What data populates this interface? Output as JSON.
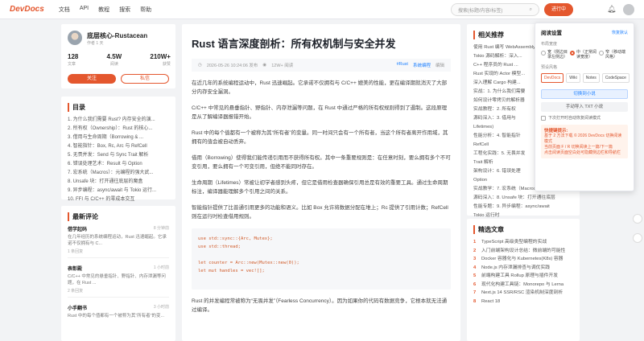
{
  "header": {
    "logo": "DevDocs",
    "nav": [
      "文档",
      "API",
      "教程",
      "搜索",
      "帮助"
    ],
    "search_placeholder": "搜索(标题/内容/标签)",
    "write_label": "进行中"
  },
  "profile": {
    "name": "底层核心-Rustacean",
    "subtitle": "作者 1 天",
    "stats": [
      {
        "value": "128",
        "label": "文章"
      },
      {
        "value": "4.5W",
        "label": "阅读"
      },
      {
        "value": "210W+",
        "label": "获赞"
      }
    ],
    "follow": "关注",
    "message": "私信"
  },
  "toc": {
    "title": "目录",
    "items": [
      "1. 为什么我们需要 Rust? 内存安全的演...",
      "2. 所有权（Ownership）：Rust 的核心...",
      "3. 借用与生命周期（Borrowing & ...",
      "4. 智能指针：Box, Rc, Arc 与 RefCell",
      "5. 无畏并发：Send 与 Sync Trait 解析",
      "6. 错误处理艺术：Result 与 Option",
      "7. 宏系统（Macros）：元编程的强大武...",
      "8. Unsafe 块：打开通往底层的魔盒",
      "9. 异步编程：async/await 与 Tokio 运行...",
      "10. FFI 与 C/C++ 的零成本交互"
    ]
  },
  "comments": {
    "title": "最新评论",
    "items": [
      {
        "user": "借学起码",
        "time": "8 分钟前",
        "text": "在几年经历的系统编程运动，Rust 迅速崛起。它承诺不仅拥有与 C...",
        "meta": "1 条回复"
      },
      {
        "user": "表彰殿",
        "time": "1 小时前",
        "text": "C/C++ 中常见的悬垂指针、野指针、内存泄漏等问题，在 Rust ...",
        "meta": "2 条回复"
      },
      {
        "user": "小手翻书",
        "time": "3 小时前",
        "text": "Rust 中的每个值都有一个被称为其“所有者”的变...",
        "meta": ""
      }
    ]
  },
  "article": {
    "title": "Rust 语言深度剖析：所有权机制与安全并发",
    "meta_date": "2026-05-26 10:24:06 发布",
    "meta_views": "12W+ 阅读",
    "meta_tag": "#Rust",
    "meta_tag2": "系统编程",
    "meta_edit": "编辑",
    "paragraphs": [
      "在近几年的系统编程运动中，Rust 迅速崛起。它承诺不仅拥有与 C/C++ 媲美的性能，更在编译期就消灭了大部分内存安全漏洞。",
      "C/C++ 中常见的悬垂指针、野指针、内存泄漏等问题，在 Rust 中通过严格的所有权规则得到了遏制。这段原理是从了解编译器报错开始。",
      "Rust 中的每个值都有一个被称为其“所有者”的变量。同一时间只会有一个所有者，当这个所有者离开作用域，其拥有的值会被自动丢弃。",
      "借用（Borrowing）使得我们能传递引用而不获得所有权。其中一条重要规则是：在任意时刻，要么拥有多个不可变引用，要么拥有一个可变引用，但绝不能同时存在。",
      "生命周期（Lifetimes）常被让初学者感到头疼，但它是借用检查器确保引用总是有效的重要工具。通过生命周期标注，编译器能理解多个引用之间的关系。",
      "智能指针提供了比普通引用更多的功能和语义。比如 Box 允许将数据分配在堆上；Rc 提供了引用计数；RefCell 则在运行时检查借用规则。"
    ],
    "code": [
      "use std::sync::{Arc, Mutex};",
      "use std::thread;",
      "",
      "let counter = Arc::new(Mutex::new(0));",
      "let mut handles = vec![];"
    ],
    "after_code": "Rust 的并发编程常被称为“无畏并发”（Fearless Concurrency）。因为如果你的代码有数据竞争，它根本就无法通过编译。"
  },
  "related": {
    "title": "相关推荐",
    "items": [
      "使用 Rust 编写 WebAssembly...",
      "Tokio 源码解析：深入...",
      "C++ 程序员的 Rust ...",
      "Rust 实现的 Actor 模型...",
      "深入理解 Cargo 构建...",
      "实战：1. 为什么我们需要",
      "如何设计零拷贝的解析器",
      "实战教程：2. 所有权",
      "源码深入：3. 借用与",
      "Lifetimes)",
      "性能分析：4. 智能指针",
      "RefCell",
      "工程化实践：5. 无畏并发",
      "Trait 解析",
      "架构设计：6. 错误处理",
      "Option",
      "实战教学：7. 宏系统（Macros）：元编程",
      "源码深入：8. Unsafe 块：打开通往底层",
      "性能专题：9. 异步编程：async/await",
      "Tokio 运行时"
    ]
  },
  "picks": {
    "title": "精选文章",
    "items": [
      "TypeScript 高级类型编程的实战",
      "入门前端架构设计总结：微前端的可能性",
      "Docker 容器化与 Kubernetes(K8s) 容器",
      "Node.js 内存泄漏排查与调优实践",
      "前端构建工具 Rollup 原理与插件开发",
      "现代化构建工具链：Monorepo 与 Lerna",
      "Next.js 14 SSR/RSC 渲染机制深度剖析",
      "React 18"
    ]
  },
  "settings_panel": {
    "title": "阅读设置",
    "reset": "恢复默认",
    "width_label": "布局宽度",
    "width_options": [
      {
        "label": "宽（侧边目录左侧边）",
        "selected": false
      },
      {
        "label": "中（正常阅读宽度）",
        "selected": true
      },
      {
        "label": "窄（移动端风格）",
        "selected": false
      }
    ],
    "preset_label": "预设风格",
    "presets": [
      {
        "label": "DevDocs",
        "selected": true
      },
      {
        "label": "Wiki",
        "selected": false
      },
      {
        "label": "Notes",
        "selected": false
      },
      {
        "label": "CodeSpace",
        "selected": false
      }
    ],
    "btn_primary": "切换到小说",
    "btn_secondary": "手动导入 TXT 小说",
    "check_label": "下次打开时自动恢复阅读模式",
    "tips_title": "快捷键提示:",
    "tips": [
      "基于 2 方法下载 © 2026 DevDocs 切换阅读模式",
      "当前页面 F / R 切换阅读上一篇/下一篇",
      "点击阅读页面空白处可隐藏侧边栏和导航栏"
    ]
  },
  "colors": {
    "accent": "#e4572e",
    "link": "#1e80ff"
  }
}
